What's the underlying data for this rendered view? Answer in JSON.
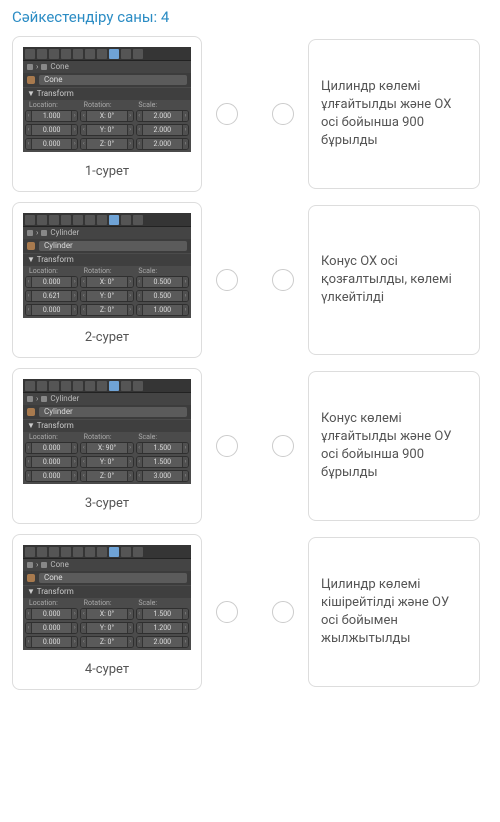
{
  "title": "Сәйкестендіру саны: 4",
  "panels": [
    {
      "caption": "1-сурет",
      "breadcrumb_label": "Cone",
      "object_name": "Cone",
      "section": "Transform",
      "headers": {
        "loc": "Location:",
        "rot": "Rotation:",
        "scale": "Scale:"
      },
      "rows": [
        {
          "loc": "1.000",
          "rot": "X: 0°",
          "scale": "2.000"
        },
        {
          "loc": "0.000",
          "rot": "Y: 0°",
          "scale": "2.000"
        },
        {
          "loc": "0.000",
          "rot": "Z: 0°",
          "scale": "2.000"
        }
      ]
    },
    {
      "caption": "2-сурет",
      "breadcrumb_label": "Cylinder",
      "object_name": "Cylinder",
      "section": "Transform",
      "headers": {
        "loc": "Location:",
        "rot": "Rotation:",
        "scale": "Scale:"
      },
      "rows": [
        {
          "loc": "0.000",
          "rot": "X: 0°",
          "scale": "0.500"
        },
        {
          "loc": "0.621",
          "rot": "Y: 0°",
          "scale": "0.500"
        },
        {
          "loc": "0.000",
          "rot": "Z: 0°",
          "scale": "1.000"
        }
      ]
    },
    {
      "caption": "3-сурет",
      "breadcrumb_label": "Cylinder",
      "object_name": "Cylinder",
      "section": "Transform",
      "headers": {
        "loc": "Location:",
        "rot": "Rotation:",
        "scale": "Scale:"
      },
      "rows": [
        {
          "loc": "0.000",
          "rot": "X: 90°",
          "scale": "1.500"
        },
        {
          "loc": "0.000",
          "rot": "Y: 0°",
          "scale": "1.500"
        },
        {
          "loc": "0.000",
          "rot": "Z: 0°",
          "scale": "3.000"
        }
      ]
    },
    {
      "caption": "4-сурет",
      "breadcrumb_label": "Cone",
      "object_name": "Cone",
      "section": "Transform",
      "headers": {
        "loc": "Location:",
        "rot": "Rotation:",
        "scale": "Scale:"
      },
      "rows": [
        {
          "loc": "0.000",
          "rot": "X: 0°",
          "scale": "1.500"
        },
        {
          "loc": "0.000",
          "rot": "Y: 0°",
          "scale": "1.200"
        },
        {
          "loc": "0.000",
          "rot": "Z: 0°",
          "scale": "2.000"
        }
      ]
    }
  ],
  "right": [
    "Цилиндр көлемі ұлғайтылды және ОХ осі бойынша 900 бұрылды",
    "Конус ОХ осі қозғалтылды, көлемі үлкейтілді",
    "Конус көлемі ұлғайтылды және ОУ осі бойынша 900 бұрылды",
    "Цилиндр көлемі кішірейтілді және ОУ осі бойымен жылжытылды"
  ]
}
